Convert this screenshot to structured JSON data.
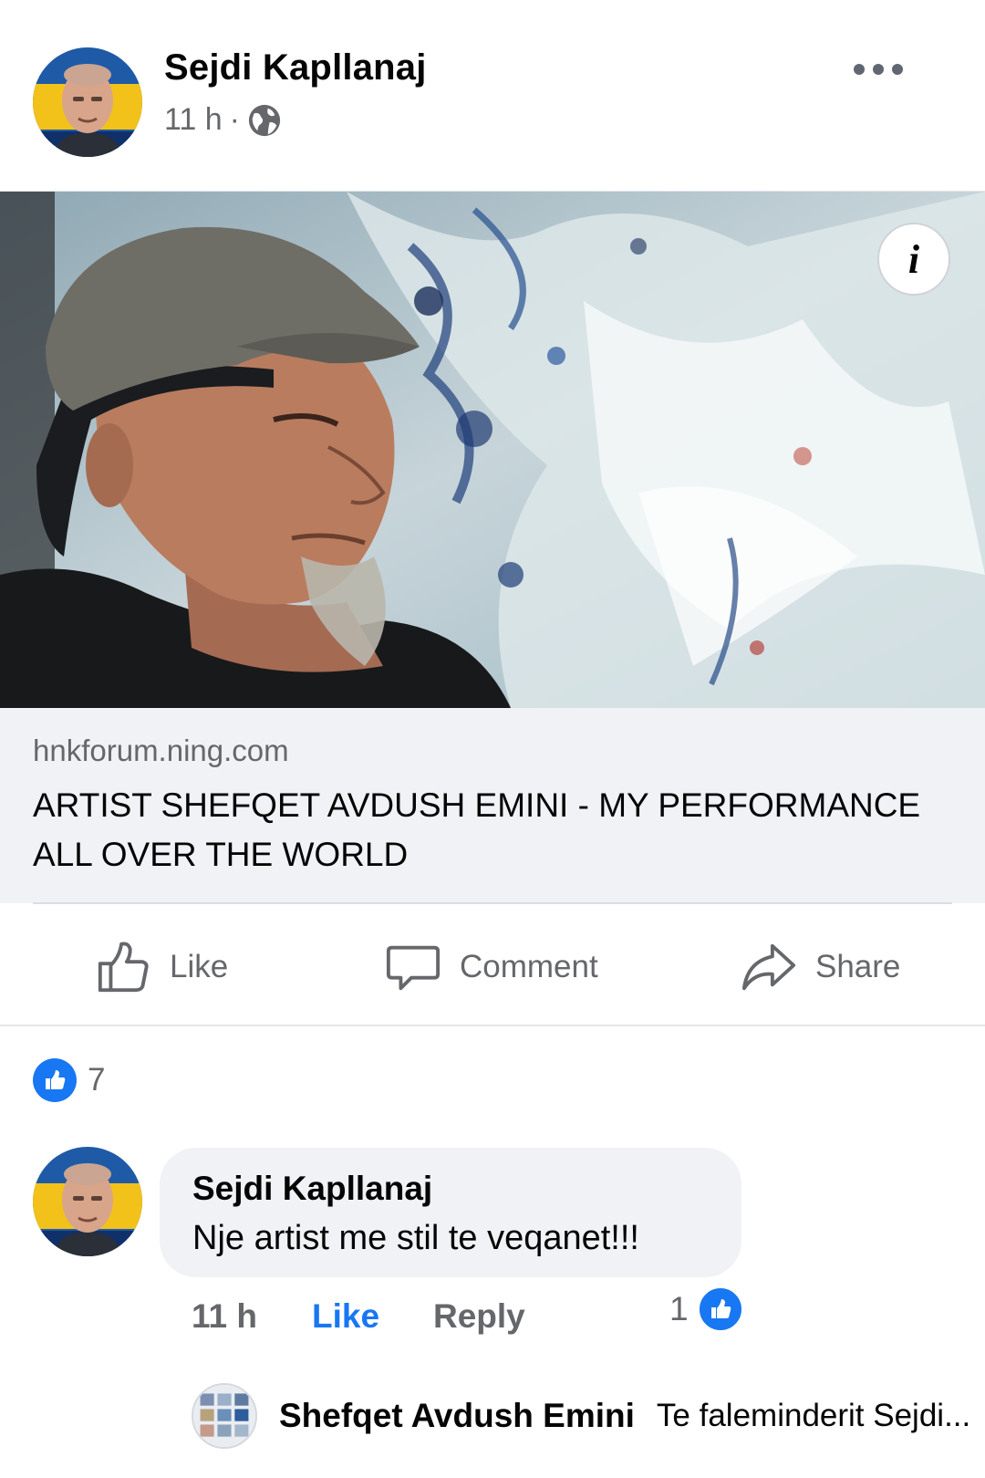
{
  "post": {
    "author": "Sejdi Kapllanaj",
    "time": "11 h",
    "separator": "·",
    "privacy_icon": "globe-icon",
    "more_icon": "more-horizontal-icon"
  },
  "link": {
    "domain": "hnkforum.ning.com",
    "title": "ARTIST SHEFQET AVDUSH EMINI - MY PERFORMANCE ALL OVER THE WORLD",
    "info_label": "i"
  },
  "actions": {
    "like": "Like",
    "comment": "Comment",
    "share": "Share"
  },
  "reactions": {
    "count": "7"
  },
  "comment": {
    "author": "Sejdi Kapllanaj",
    "text": "Nje artist me stil te veqanet!!!",
    "time": "11 h",
    "like": "Like",
    "reply": "Reply",
    "reaction_count": "1"
  },
  "reply": {
    "author": "Shefqet Avdush Emini",
    "text": "Te faleminderit Sejdi..."
  },
  "colors": {
    "brand_blue": "#1877f2",
    "secondary_text": "#65676b",
    "card_bg": "#f0f2f5"
  }
}
